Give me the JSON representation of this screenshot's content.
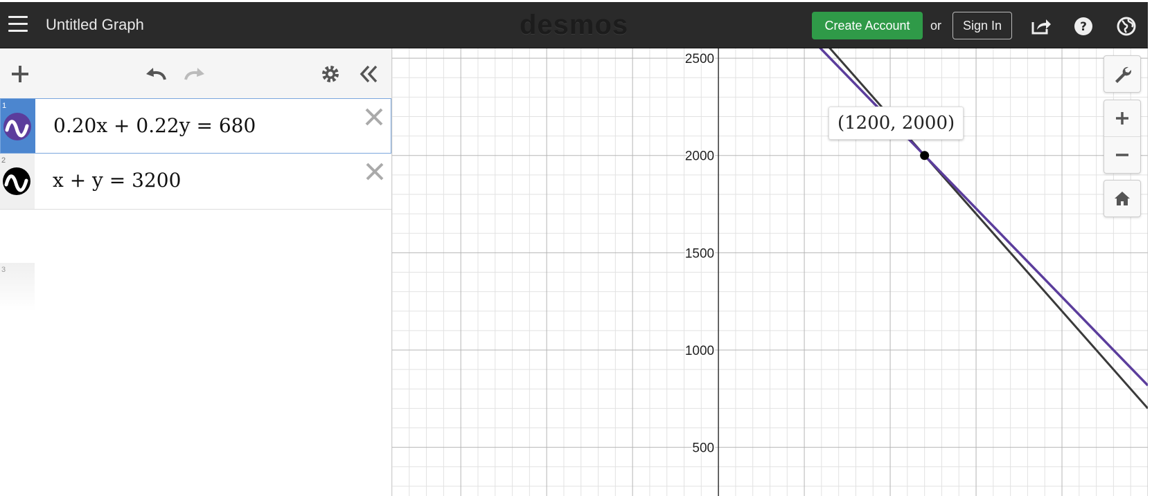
{
  "header": {
    "graph_title": "Untitled Graph",
    "logo_text": "desmos",
    "create_account_label": "Create Account",
    "or_label": "or",
    "sign_in_label": "Sign In",
    "colors": {
      "bar": "#2a2a2a",
      "create": "#2f9a48"
    }
  },
  "expressions": [
    {
      "index": "1",
      "latex": "0.20x + 0.22y = 680",
      "color": "#5b3d9c",
      "active": true
    },
    {
      "index": "2",
      "latex": "x + y = 3200",
      "color": "#000000",
      "active": false
    },
    {
      "index": "3",
      "latex": "",
      "color": "",
      "active": false
    }
  ],
  "graph": {
    "y_ticks": [
      "2500",
      "2000",
      "1500",
      "1000",
      "500"
    ],
    "point_label": "(1200, 2000)"
  },
  "chart_data": {
    "type": "line",
    "series": [
      {
        "equation": "0.20x + 0.22y = 680",
        "color": "#5b3d9c"
      },
      {
        "equation": "x + y = 3200",
        "color": "#3a3a3a"
      }
    ],
    "points": [
      {
        "x": 1200,
        "y": 2000,
        "label": "(1200, 2000)"
      }
    ],
    "xlim": [
      -1900,
      2500
    ],
    "ylim": [
      250,
      2550
    ],
    "y_ticks": [
      500,
      1000,
      1500,
      2000,
      2500
    ],
    "grid": true
  }
}
